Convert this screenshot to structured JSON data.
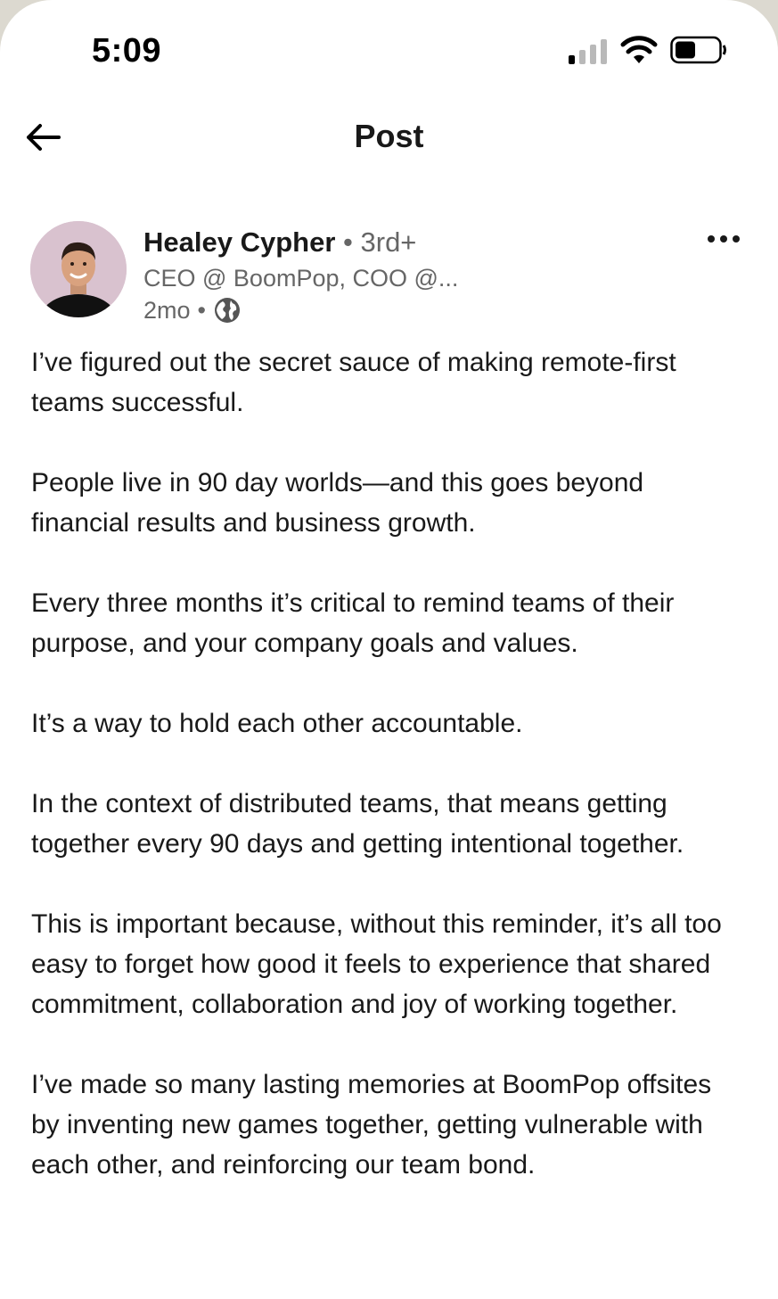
{
  "status_bar": {
    "time": "5:09"
  },
  "nav": {
    "title": "Post"
  },
  "post": {
    "author": {
      "name": "Healey Cypher",
      "separator": "•",
      "degree": "3rd+",
      "headline": "CEO @ BoomPop, COO @...",
      "time_ago": "2mo",
      "meta_separator": "•",
      "visibility_icon": "globe-icon"
    },
    "paragraphs": [
      "I’ve figured out the secret sauce of making remote-first teams successful.",
      "People live in 90 day worlds—and this goes beyond financial results and business growth.",
      "Every three months it’s critical to remind teams of their purpose, and your company goals and values.",
      "It’s a way to hold each other accountable.",
      "In the context of distributed teams, that means getting together every 90 days and getting intentional together.",
      "This is important because, without this reminder, it’s all too easy to forget how good it feels to experience that shared commitment, collaboration and joy of working together.",
      "I’ve made so many lasting memories at BoomPop offsites by inventing new games together, getting vulnerable with each other, and reinforcing our team bond."
    ]
  },
  "colors": {
    "text_primary": "#191919",
    "text_secondary": "#666666",
    "background": "#ffffff",
    "avatar_bg": "#d9c2cf"
  }
}
